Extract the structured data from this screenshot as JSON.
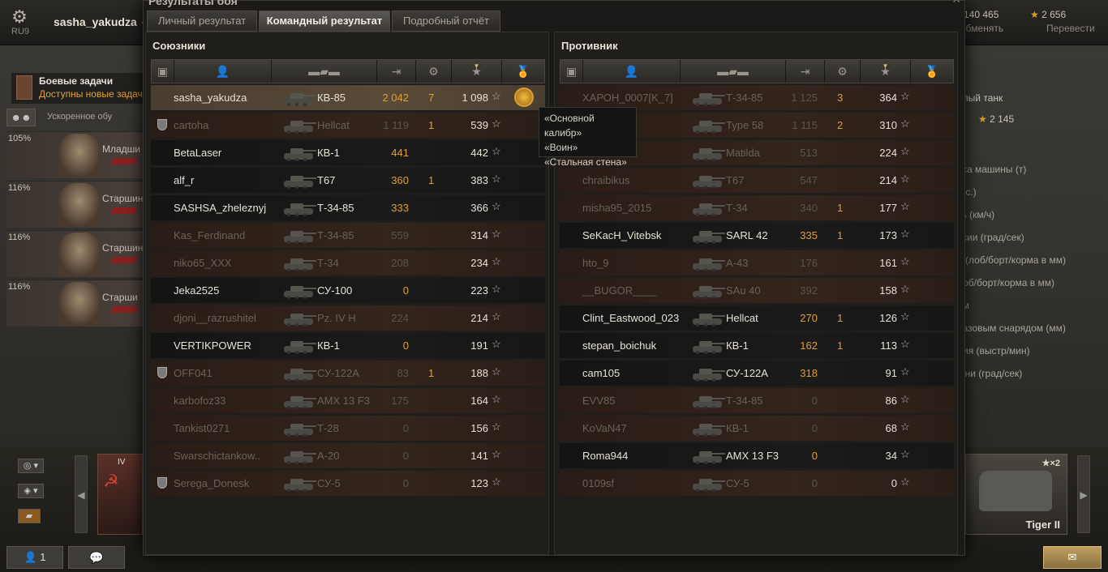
{
  "topbar": {
    "region": "RU9",
    "username": "sasha_yakudza",
    "gold_value": "5 140 465",
    "gold_action": "обменять",
    "free_xp_value": "2 656",
    "free_xp_action": "Перевести"
  },
  "quests": {
    "title": "Боевые задачи",
    "subtitle": "Доступны новые задач"
  },
  "accelerated_training": "Ускоренное обу",
  "crew": [
    {
      "pct": "105%",
      "rank": "Младши"
    },
    {
      "pct": "116%",
      "rank": "Старшин"
    },
    {
      "pct": "116%",
      "rank": "Старшин"
    },
    {
      "pct": "116%",
      "rank": "Старши"
    }
  ],
  "right_stats": {
    "header": "ёлый танк",
    "value": "2 145",
    "items": [
      "сса машины (т)",
      "л.с.)",
      "ть (км/ч)",
      "ссии (град/сек)",
      "а (лоб/борт/корма в мм)",
      "лоб/борт/корма в мм)",
      "ом",
      "базовым снарядом (мм)",
      "дия (выстр/мин)",
      "шни (град/сек)"
    ]
  },
  "carousel": {
    "left_card_tier": "IV",
    "right_card_name": "Tiger II",
    "right_card_badge": "×2",
    "right_card_tier": "II"
  },
  "bottom": {
    "players_count": "1"
  },
  "window": {
    "title": "Результаты боя",
    "tabs": [
      "Личный результат",
      "Командный результат",
      "Подробный отчёт"
    ],
    "active_tab": 1
  },
  "allies": {
    "title": "Союзники",
    "rows": [
      {
        "name": "sasha_yakudza",
        "tank": "КВ-85",
        "damage": "2 042",
        "kills": "7",
        "xp": "1 098",
        "state": "self",
        "clan": false,
        "medal": true
      },
      {
        "name": "cartoha",
        "tank": "Hellcat",
        "damage": "1 119",
        "kills": "1",
        "xp": "539",
        "state": "dead",
        "clan": true,
        "medal": false
      },
      {
        "name": "BetaLaser",
        "tank": "КВ-1",
        "damage": "441",
        "kills": "",
        "xp": "442",
        "state": "alive",
        "clan": false,
        "medal": false
      },
      {
        "name": "alf_r",
        "tank": "T67",
        "damage": "360",
        "kills": "1",
        "xp": "383",
        "state": "alive",
        "clan": false,
        "medal": false
      },
      {
        "name": "SASHSA_zheleznyj",
        "tank": "Т-34-85",
        "damage": "333",
        "kills": "",
        "xp": "366",
        "state": "alive",
        "clan": false,
        "medal": false
      },
      {
        "name": "Kas_Ferdinand",
        "tank": "Т-34-85",
        "damage": "559",
        "kills": "",
        "xp": "314",
        "state": "dead",
        "clan": false,
        "medal": false
      },
      {
        "name": "niko65_XXX",
        "tank": "Т-34",
        "damage": "208",
        "kills": "",
        "xp": "234",
        "state": "dead",
        "clan": false,
        "medal": false
      },
      {
        "name": "Jeka2525",
        "tank": "СУ-100",
        "damage": "0",
        "kills": "",
        "xp": "223",
        "state": "alive",
        "clan": false,
        "medal": false
      },
      {
        "name": "djoni__razrushitel",
        "tank": "Pz. IV H",
        "damage": "224",
        "kills": "",
        "xp": "214",
        "state": "dead",
        "clan": false,
        "medal": false
      },
      {
        "name": "VERTIKPOWER",
        "tank": "КВ-1",
        "damage": "0",
        "kills": "",
        "xp": "191",
        "state": "alive",
        "clan": false,
        "medal": false
      },
      {
        "name": "OFF041",
        "tank": "СУ-122А",
        "damage": "83",
        "kills": "1",
        "xp": "188",
        "state": "dead",
        "clan": true,
        "medal": false
      },
      {
        "name": "karbofoz33",
        "tank": "AMX 13 F3",
        "damage": "175",
        "kills": "",
        "xp": "164",
        "state": "dead",
        "clan": false,
        "medal": false
      },
      {
        "name": "Tankist0271",
        "tank": "Т-28",
        "damage": "0",
        "kills": "",
        "xp": "156",
        "state": "dead",
        "clan": false,
        "medal": false
      },
      {
        "name": "Swarschictankow..",
        "tank": "A-20",
        "damage": "0",
        "kills": "",
        "xp": "141",
        "state": "dead",
        "clan": false,
        "medal": false
      },
      {
        "name": "Serega_Donesk",
        "tank": "СУ-5",
        "damage": "0",
        "kills": "",
        "xp": "123",
        "state": "dead",
        "clan": true,
        "medal": false
      }
    ]
  },
  "enemies": {
    "title": "Противник",
    "rows": [
      {
        "name": "ХАРОН_0007[K_7]",
        "tank": "Т-34-85",
        "damage": "1 125",
        "kills": "3",
        "xp": "364",
        "state": "dead"
      },
      {
        "name": "",
        "tank": "Type 58",
        "damage": "1 115",
        "kills": "2",
        "xp": "310",
        "state": "dead"
      },
      {
        "name": "",
        "tank": "Matilda",
        "damage": "513",
        "kills": "",
        "xp": "224",
        "state": "dead"
      },
      {
        "name": "chraibikus",
        "tank": "T67",
        "damage": "547",
        "kills": "",
        "xp": "214",
        "state": "dead"
      },
      {
        "name": "misha95_2015",
        "tank": "Т-34",
        "damage": "340",
        "kills": "1",
        "xp": "177",
        "state": "dead"
      },
      {
        "name": "SeKacH_Vitebsk",
        "tank": "SARL 42",
        "damage": "335",
        "kills": "1",
        "xp": "173",
        "state": "alive"
      },
      {
        "name": "hto_9",
        "tank": "А-43",
        "damage": "176",
        "kills": "",
        "xp": "161",
        "state": "dead"
      },
      {
        "name": "__BUGOR____",
        "tank": "SAu 40",
        "damage": "392",
        "kills": "",
        "xp": "158",
        "state": "dead"
      },
      {
        "name": "Clint_Eastwood_023",
        "tank": "Hellcat",
        "damage": "270",
        "kills": "1",
        "xp": "126",
        "state": "alive"
      },
      {
        "name": "stepan_boichuk",
        "tank": "КВ-1",
        "damage": "162",
        "kills": "1",
        "xp": "113",
        "state": "alive"
      },
      {
        "name": "cam105",
        "tank": "СУ-122А",
        "damage": "318",
        "kills": "",
        "xp": "91",
        "state": "alive"
      },
      {
        "name": "EVV85",
        "tank": "Т-34-85",
        "damage": "0",
        "kills": "",
        "xp": "86",
        "state": "dead"
      },
      {
        "name": "KoVaN47",
        "tank": "КВ-1",
        "damage": "0",
        "kills": "",
        "xp": "68",
        "state": "dead"
      },
      {
        "name": "Roma944",
        "tank": "AMX 13 F3",
        "damage": "0",
        "kills": "",
        "xp": "34",
        "state": "alive"
      },
      {
        "name": "0109sf",
        "tank": "СУ-5",
        "damage": "0",
        "kills": "",
        "xp": "0",
        "state": "dead"
      }
    ]
  },
  "tooltip": [
    "«Основной калибр»",
    "«Воин»",
    "«Стальная стена»"
  ]
}
